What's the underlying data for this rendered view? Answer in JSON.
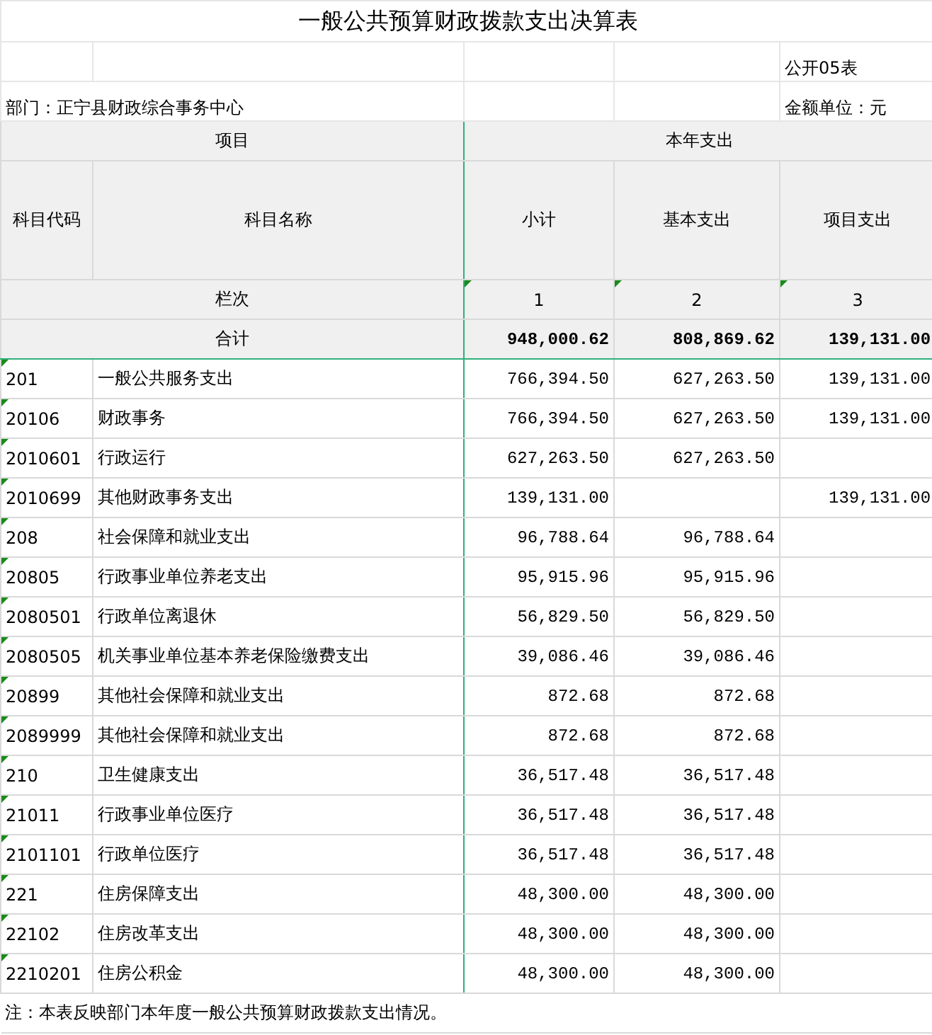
{
  "title": "一般公共预算财政拨款支出决算表",
  "form_no": "公开05表",
  "department": "部门：正宁县财政综合事务中心",
  "unit": "金额单位：元",
  "header": {
    "group_item": "项目",
    "group_year": "本年支出",
    "columns": [
      "科目代码",
      "科目名称",
      "小计",
      "基本支出",
      "项目支出"
    ],
    "index_label": "栏次",
    "index_numbers": [
      "1",
      "2",
      "3"
    ],
    "total_label": "合计",
    "totals": [
      "948,000.62",
      "808,869.62",
      "139,131.00"
    ]
  },
  "rows": [
    {
      "code": "201",
      "name": "一般公共服务支出",
      "subtotal": "766,394.50",
      "basic": "627,263.50",
      "project": "139,131.00"
    },
    {
      "code": "20106",
      "name": "财政事务",
      "subtotal": "766,394.50",
      "basic": "627,263.50",
      "project": "139,131.00"
    },
    {
      "code": "2010601",
      "name": "行政运行",
      "subtotal": "627,263.50",
      "basic": "627,263.50"
    },
    {
      "code": "2010699",
      "name": "其他财政事务支出",
      "subtotal": "139,131.00",
      "project": "139,131.00"
    },
    {
      "code": "208",
      "name": "社会保障和就业支出",
      "subtotal": "96,788.64",
      "basic": "96,788.64"
    },
    {
      "code": "20805",
      "name": "行政事业单位养老支出",
      "subtotal": "95,915.96",
      "basic": "95,915.96"
    },
    {
      "code": "2080501",
      "name": "行政单位离退休",
      "subtotal": "56,829.50",
      "basic": "56,829.50"
    },
    {
      "code": "2080505",
      "name": "机关事业单位基本养老保险缴费支出",
      "subtotal": "39,086.46",
      "basic": "39,086.46"
    },
    {
      "code": "20899",
      "name": "其他社会保障和就业支出",
      "subtotal": "872.68",
      "basic": "872.68"
    },
    {
      "code": "2089999",
      "name": "其他社会保障和就业支出",
      "subtotal": "872.68",
      "basic": "872.68"
    },
    {
      "code": "210",
      "name": "卫生健康支出",
      "subtotal": "36,517.48",
      "basic": "36,517.48"
    },
    {
      "code": "21011",
      "name": "行政事业单位医疗",
      "subtotal": "36,517.48",
      "basic": "36,517.48"
    },
    {
      "code": "2101101",
      "name": "行政单位医疗",
      "subtotal": "36,517.48",
      "basic": "36,517.48"
    },
    {
      "code": "221",
      "name": "住房保障支出",
      "subtotal": "48,300.00",
      "basic": "48,300.00"
    },
    {
      "code": "22102",
      "name": "住房改革支出",
      "subtotal": "48,300.00",
      "basic": "48,300.00"
    },
    {
      "code": "2210201",
      "name": "住房公积金",
      "subtotal": "48,300.00",
      "basic": "48,300.00"
    }
  ],
  "note": "注：本表反映部门本年度一般公共预算财政拨款支出情况。"
}
